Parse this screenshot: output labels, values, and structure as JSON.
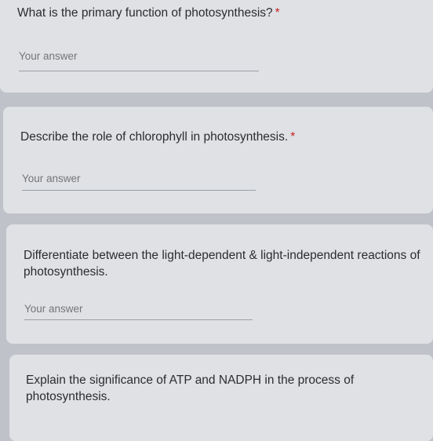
{
  "questions": [
    {
      "text": "What is the primary function of photosynthesis?",
      "required": "*",
      "answer_placeholder": "Your answer"
    },
    {
      "text": "Describe the role of chlorophyll in photosynthesis.",
      "required": "*",
      "answer_placeholder": "Your answer"
    },
    {
      "text": "Differentiate between the light-dependent & light-independent reactions of photosynthesis.",
      "required": "",
      "answer_placeholder": "Your answer"
    },
    {
      "text": "Explain the significance of ATP and NADPH in the process of photosynthesis.",
      "required": "",
      "answer_placeholder": ""
    }
  ],
  "colors": {
    "background": "#bfc2c8",
    "card": "#dfe1e5",
    "required_star": "#c5221f"
  }
}
